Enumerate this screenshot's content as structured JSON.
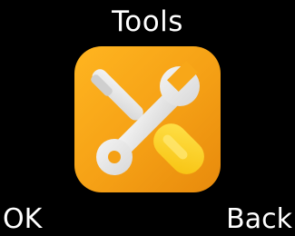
{
  "header": {
    "title": "Tools"
  },
  "main": {
    "app_icon": "tools-icon",
    "colors": {
      "background": "#000000",
      "icon_orange": "#F5A015",
      "icon_yellow": "#FFD21A",
      "tool_gray": "#E6E6E6"
    }
  },
  "softkeys": {
    "left_label": "OK",
    "right_label": "Back"
  }
}
